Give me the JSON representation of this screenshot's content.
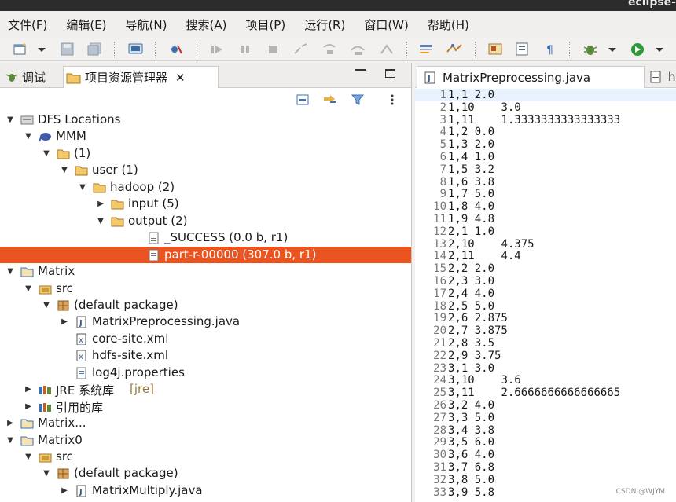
{
  "window": {
    "title": "eclipse-"
  },
  "menu": [
    "文件(F)",
    "编辑(E)",
    "导航(N)",
    "搜索(A)",
    "项目(P)",
    "运行(R)",
    "窗口(W)",
    "帮助(H)"
  ],
  "left_tabs": {
    "debug": "调试",
    "explorer": "项目资源管理器"
  },
  "tree": [
    {
      "label": "DFS Locations",
      "icon": "dfs-icon",
      "arrow": "down",
      "level": 0
    },
    {
      "label": "MMM",
      "icon": "hadoop-elephant-icon",
      "arrow": "down",
      "level": 1
    },
    {
      "label": "(1)",
      "icon": "folder-icon",
      "arrow": "down",
      "level": 2
    },
    {
      "label": "user (1)",
      "icon": "folder-icon",
      "arrow": "down",
      "level": 3
    },
    {
      "label": "hadoop (2)",
      "icon": "folder-icon",
      "arrow": "down",
      "level": 4
    },
    {
      "label": "input (5)",
      "icon": "folder-icon",
      "arrow": "right",
      "level": 5
    },
    {
      "label": "output (2)",
      "icon": "folder-icon",
      "arrow": "down",
      "level": 5
    },
    {
      "label": "_SUCCESS (0.0 b, r1)",
      "icon": "file-icon",
      "arrow": "",
      "level": 7
    },
    {
      "label": "part-r-00000 (307.0 b, r1)",
      "icon": "file-icon",
      "arrow": "",
      "level": 7,
      "selected": true
    },
    {
      "label": "Matrix",
      "icon": "project-icon",
      "arrow": "down",
      "level": 0
    },
    {
      "label": "src",
      "icon": "src-folder-icon",
      "arrow": "down",
      "level": 1
    },
    {
      "label": "(default package)",
      "icon": "package-icon",
      "arrow": "down",
      "level": 2
    },
    {
      "label": "MatrixPreprocessing.java",
      "icon": "java-file-icon",
      "arrow": "right",
      "level": 3
    },
    {
      "label": "core-site.xml",
      "icon": "xml-file-icon",
      "arrow": "",
      "level": 3
    },
    {
      "label": "hdfs-site.xml",
      "icon": "xml-file-icon",
      "arrow": "",
      "level": 3
    },
    {
      "label": "log4j.properties",
      "icon": "properties-file-icon",
      "arrow": "",
      "level": 3
    },
    {
      "label": "JRE 系统库",
      "deco": "[jre]",
      "icon": "library-icon",
      "arrow": "right",
      "level": 1
    },
    {
      "label": "引用的库",
      "icon": "library-icon",
      "arrow": "right",
      "level": 1
    },
    {
      "label": "Matrix...",
      "icon": "project-icon",
      "arrow": "right",
      "level": 0
    },
    {
      "label": "Matrix0",
      "icon": "project-icon",
      "arrow": "down",
      "level": 0
    },
    {
      "label": "src",
      "icon": "src-folder-icon",
      "arrow": "down",
      "level": 1
    },
    {
      "label": "(default package)",
      "icon": "package-icon",
      "arrow": "down",
      "level": 2
    },
    {
      "label": "MatrixMultiply.java",
      "icon": "java-file-icon",
      "arrow": "right",
      "level": 3
    }
  ],
  "editor_tabs": {
    "active": "MatrixPreprocessing.java",
    "next": "h"
  },
  "editor_lines": [
    "1,1 2.0",
    "1,10\t3.0",
    "1,11\t1.3333333333333333",
    "1,2 0.0",
    "1,3 2.0",
    "1,4 1.0",
    "1,5 3.2",
    "1,6 3.8",
    "1,7 5.0",
    "1,8 4.0",
    "1,9 4.8",
    "2,1 1.0",
    "2,10\t4.375",
    "2,11\t4.4",
    "2,2 2.0",
    "2,3 3.0",
    "2,4 4.0",
    "2,5 5.0",
    "2,6 2.875",
    "2,7 3.875",
    "2,8 3.5",
    "2,9 3.75",
    "3,1 3.0",
    "3,10\t3.6",
    "3,11\t2.6666666666666665",
    "3,2 4.0",
    "3,3 5.0",
    "3,4 3.8",
    "3,5 6.0",
    "3,6 4.0",
    "3,7 6.8",
    "3,8 5.0",
    "3,9 5.8"
  ],
  "watermark": "CSDN @WJYM",
  "colors": {
    "selection": "#e95420",
    "current_line": "#e8f2fe"
  }
}
